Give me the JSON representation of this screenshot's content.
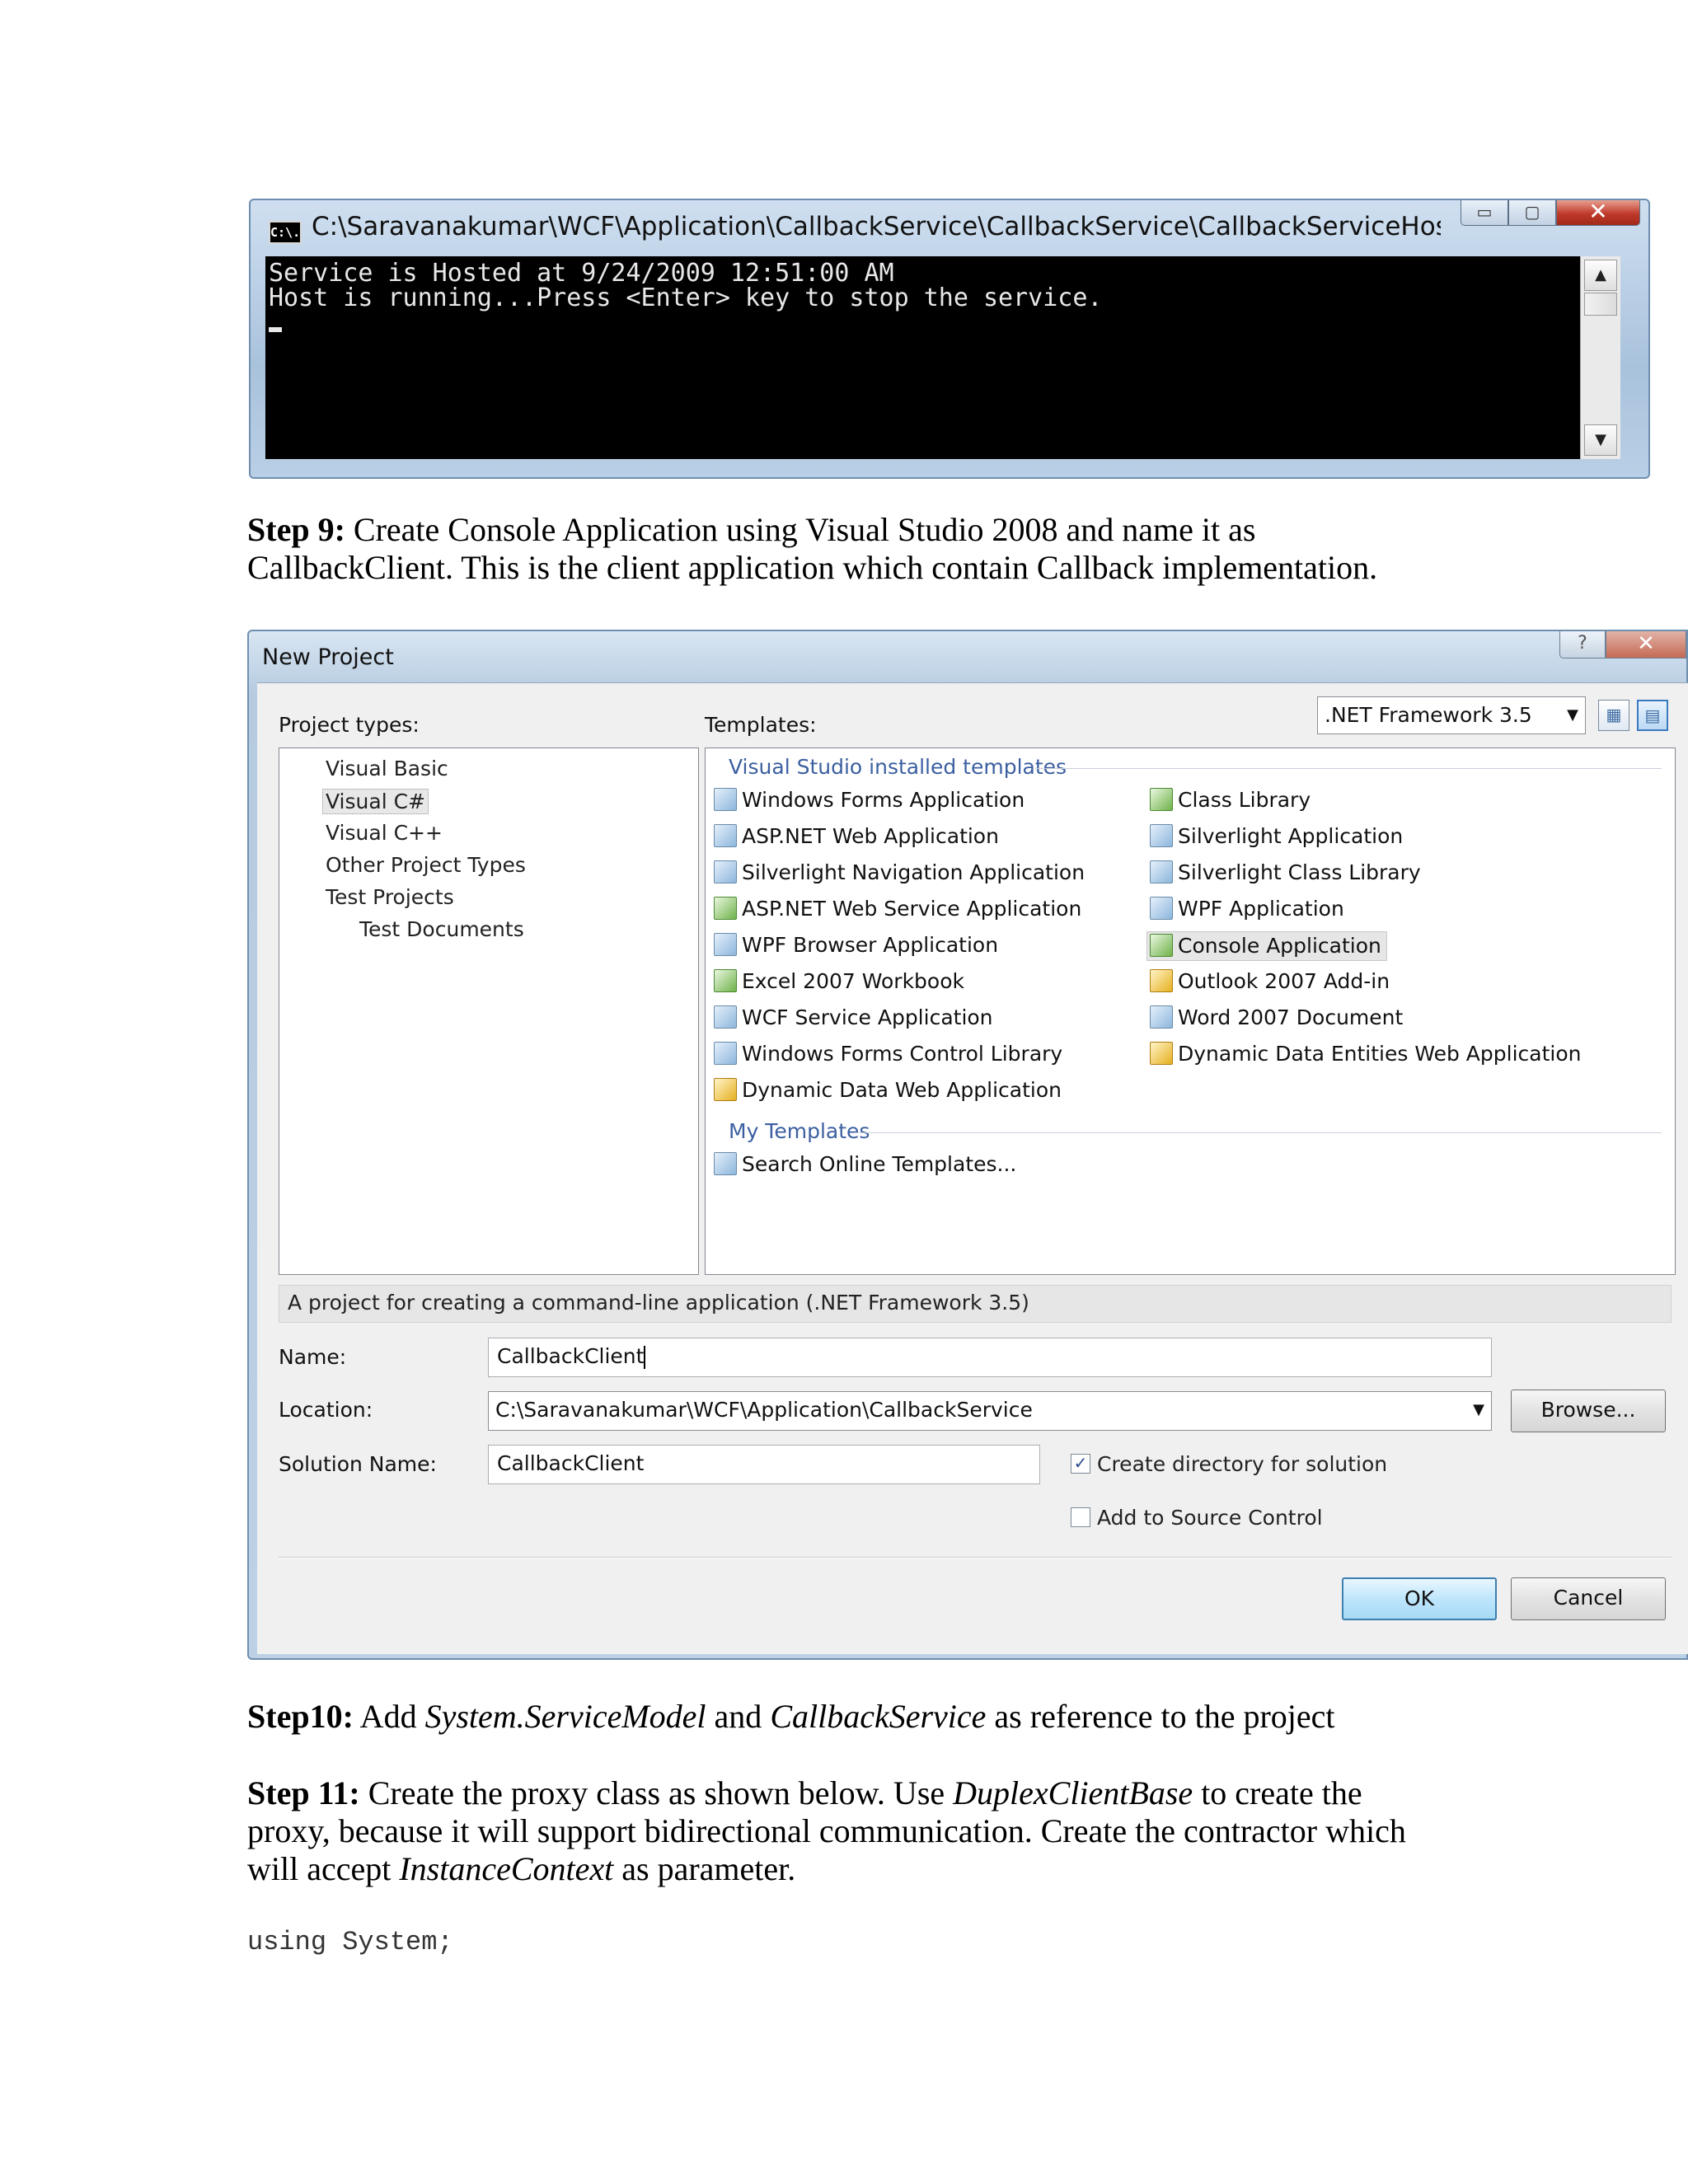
{
  "console": {
    "title": "C:\\Saravanakumar\\WCF\\Application\\CallbackService\\CallbackService\\CallbackServiceHost\\bin\\Debu...",
    "icon_text": "C:\\.",
    "lines": [
      "Service is Hosted at 9/24/2009 12:51:00 AM",
      "Host is running...Press <Enter> key to stop the service."
    ]
  },
  "step9": {
    "label": "Step 9:",
    "text": " Create Console Application using Visual Studio 2008 and name it as CallbackClient. This is the client application which contain Callback implementation."
  },
  "dialog": {
    "title": "New Project",
    "project_types_label": "Project types:",
    "templates_label": "Templates:",
    "framework": ".NET Framework 3.5",
    "project_types": [
      {
        "label": "Visual Basic",
        "indent": 1
      },
      {
        "label": "Visual C#",
        "indent": 1,
        "selected": true
      },
      {
        "label": "Visual C++",
        "indent": 1
      },
      {
        "label": "Other Project Types",
        "indent": 1
      },
      {
        "label": "Test Projects",
        "indent": 1
      },
      {
        "label": "Test Documents",
        "indent": 2
      }
    ],
    "installed_group": "Visual Studio installed templates",
    "templates_left": [
      {
        "label": "Windows Forms Application",
        "icon": "windows-forms-icon"
      },
      {
        "label": "ASP.NET Web Application",
        "icon": "aspnet-web-icon"
      },
      {
        "label": "Silverlight Navigation Application",
        "icon": "silverlight-nav-icon"
      },
      {
        "label": "ASP.NET Web Service Application",
        "icon": "aspnet-service-icon"
      },
      {
        "label": "WPF Browser Application",
        "icon": "wpf-browser-icon"
      },
      {
        "label": "Excel 2007 Workbook",
        "icon": "excel-icon"
      },
      {
        "label": "WCF Service Application",
        "icon": "wcf-service-icon"
      },
      {
        "label": "Windows Forms Control Library",
        "icon": "control-library-icon"
      },
      {
        "label": "Dynamic Data Web Application",
        "icon": "dynamic-data-icon"
      }
    ],
    "templates_right": [
      {
        "label": "Class Library",
        "icon": "class-library-icon"
      },
      {
        "label": "Silverlight Application",
        "icon": "silverlight-app-icon"
      },
      {
        "label": "Silverlight Class Library",
        "icon": "silverlight-lib-icon"
      },
      {
        "label": "WPF Application",
        "icon": "wpf-app-icon"
      },
      {
        "label": "Console Application",
        "icon": "console-app-icon",
        "selected": true
      },
      {
        "label": "Outlook 2007 Add-in",
        "icon": "outlook-icon"
      },
      {
        "label": "Word 2007 Document",
        "icon": "word-icon"
      },
      {
        "label": "Dynamic Data Entities Web Application",
        "icon": "dynamic-entities-icon"
      }
    ],
    "my_templates_group": "My Templates",
    "search_online": "Search Online Templates...",
    "description": "A project for creating a command-line application (.NET Framework 3.5)",
    "name_label": "Name:",
    "name_value": "CallbackClient",
    "location_label": "Location:",
    "location_value": "C:\\Saravanakumar\\WCF\\Application\\CallbackService",
    "solution_label": "Solution Name:",
    "solution_value": "CallbackClient",
    "browse_label": "Browse...",
    "create_dir_label": "Create directory for solution",
    "create_dir_checked": true,
    "source_control_label": "Add to Source Control",
    "source_control_checked": false,
    "ok_label": "OK",
    "cancel_label": "Cancel"
  },
  "step10": {
    "label": "Step10:",
    "text1": " Add ",
    "em1": "System.ServiceModel",
    "text2": " and ",
    "em2": "CallbackService",
    "text3": " as reference to the project"
  },
  "step11": {
    "label": "Step 11:",
    "text1": " Create the proxy class as shown below. Use ",
    "em1": "DuplexClientBase",
    "text2": " to create the proxy, because it will support bidirectional communication. Create the contractor which will accept ",
    "em2": "InstanceContext",
    "text3": " as parameter."
  },
  "code_line": "using System;"
}
